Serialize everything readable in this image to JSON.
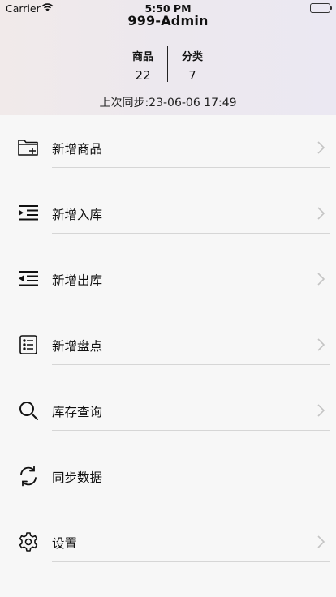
{
  "status_bar": {
    "carrier": "Carrier",
    "time": "5:50 PM"
  },
  "header": {
    "title": "999-Admin",
    "stats": [
      {
        "label": "商品",
        "value": "22"
      },
      {
        "label": "分类",
        "value": "7"
      }
    ],
    "sync_text": "上次同步:23-06-06 17:49"
  },
  "menu": [
    {
      "label": "新增商品",
      "icon": "folder-add-icon"
    },
    {
      "label": "新增入库",
      "icon": "indent-in-icon"
    },
    {
      "label": "新增出库",
      "icon": "indent-out-icon"
    },
    {
      "label": "新增盘点",
      "icon": "list-check-icon"
    },
    {
      "label": "库存查询",
      "icon": "search-icon"
    },
    {
      "label": "同步数据",
      "icon": "sync-icon"
    },
    {
      "label": "设置",
      "icon": "gear-icon"
    }
  ]
}
